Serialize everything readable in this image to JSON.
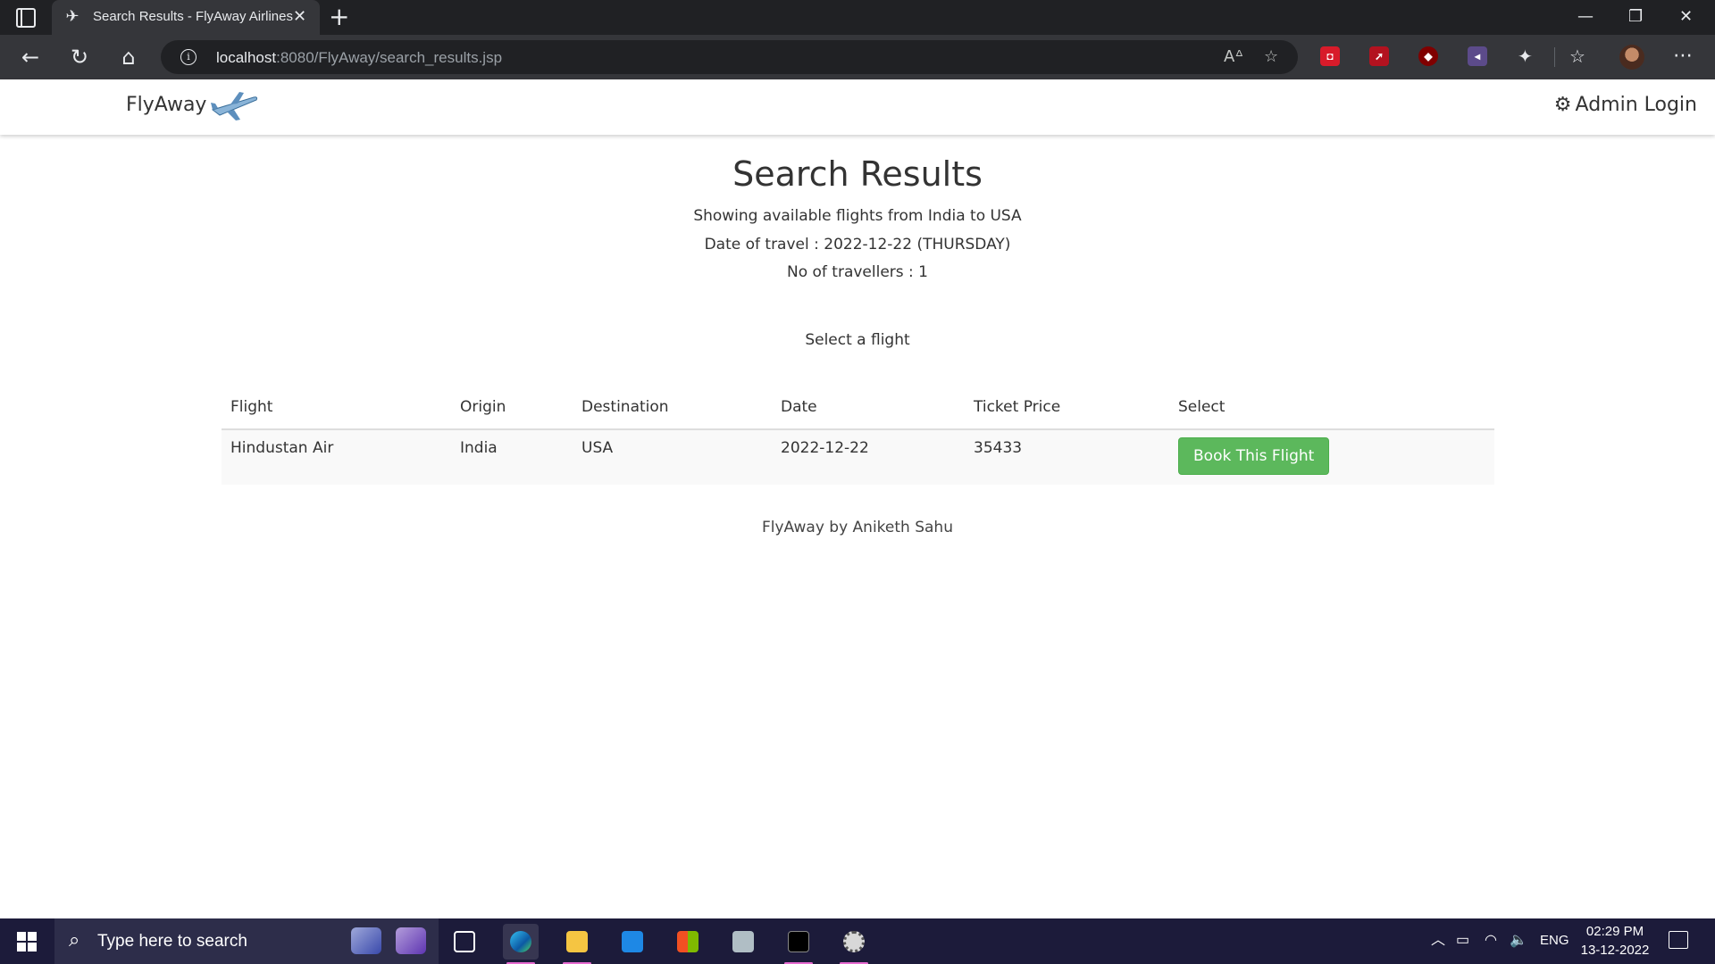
{
  "browser": {
    "tab_title": "Search Results - FlyAway Airlines",
    "url_host": "localhost",
    "url_path": ":8080/FlyAway/search_results.jsp"
  },
  "navbar": {
    "brand": "FlyAway",
    "admin_login": "Admin Login"
  },
  "main": {
    "title": "Search Results",
    "route_text": "Showing available flights from India to USA",
    "date_text": "Date of travel : 2022-12-22 (THURSDAY)",
    "travellers_text": "No of travellers : 1",
    "select_prompt": "Select a flight"
  },
  "table": {
    "headers": [
      "Flight",
      "Origin",
      "Destination",
      "Date",
      "Ticket Price",
      "Select"
    ],
    "rows": [
      {
        "flight": "Hindustan Air",
        "origin": "India",
        "destination": "USA",
        "date": "2022-12-22",
        "price": "35433",
        "button": "Book This Flight"
      }
    ]
  },
  "footer": "FlyAway by Aniketh Sahu",
  "taskbar": {
    "search_placeholder": "Type here to search",
    "language": "ENG",
    "time": "02:29 PM",
    "date": "13-12-2022"
  },
  "colors": {
    "book_button": "#5cb85c",
    "chrome_dark": "#202124",
    "taskbar": "#1c1b3a"
  }
}
